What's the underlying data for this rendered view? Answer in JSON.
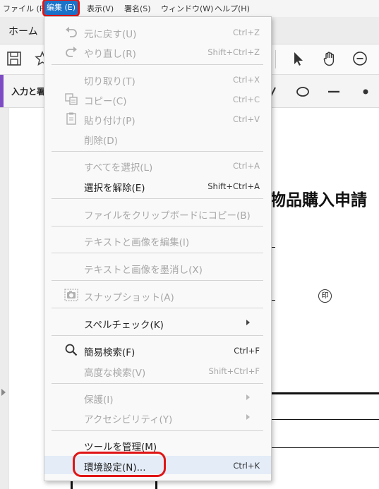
{
  "menubar": {
    "items": [
      "ファイル (F)",
      "編集 (E)",
      "表示(V)",
      "署名(S)",
      "ウィンドウ(W)",
      "ヘルプ(H)"
    ]
  },
  "tabs": {
    "home": "ホーム"
  },
  "fillbar": {
    "label": "入力と署"
  },
  "document": {
    "title": "物品購入申請",
    "seal": "印"
  },
  "edit_menu": {
    "undo": {
      "label": "元に戻す(U)",
      "shortcut": "Ctrl+Z"
    },
    "redo": {
      "label": "やり直し(R)",
      "shortcut": "Shift+Ctrl+Z"
    },
    "cut": {
      "label": "切り取り(T)",
      "shortcut": "Ctrl+X"
    },
    "copy": {
      "label": "コピー(C)",
      "shortcut": "Ctrl+C"
    },
    "paste": {
      "label": "貼り付け(P)",
      "shortcut": "Ctrl+V"
    },
    "delete": {
      "label": "削除(D)"
    },
    "select_all": {
      "label": "すべてを選択(L)",
      "shortcut": "Ctrl+A"
    },
    "deselect": {
      "label": "選択を解除(E)",
      "shortcut": "Shift+Ctrl+A"
    },
    "copy_file_clipboard": {
      "label": "ファイルをクリップボードにコピー(B)"
    },
    "edit_text_image": {
      "label": "テキストと画像を編集(I)"
    },
    "redact_text_image": {
      "label": "テキストと画像を墨消し(X)"
    },
    "snapshot": {
      "label": "スナップショット(A)"
    },
    "spellcheck": {
      "label": "スペルチェック(K)"
    },
    "find": {
      "label": "簡易検索(F)",
      "shortcut": "Ctrl+F"
    },
    "advanced_search": {
      "label": "高度な検索(V)",
      "shortcut": "Shift+Ctrl+F"
    },
    "protect": {
      "label": "保護(I)"
    },
    "accessibility": {
      "label": "アクセシビリティ(Y)"
    },
    "manage_tools": {
      "label": "ツールを管理(M)"
    },
    "preferences": {
      "label": "環境設定(N)...",
      "shortcut": "Ctrl+K"
    }
  },
  "colors": {
    "menu_active": "#1a73c9",
    "annotation_red": "#e01515",
    "fill_accent": "#7d4cc4"
  }
}
